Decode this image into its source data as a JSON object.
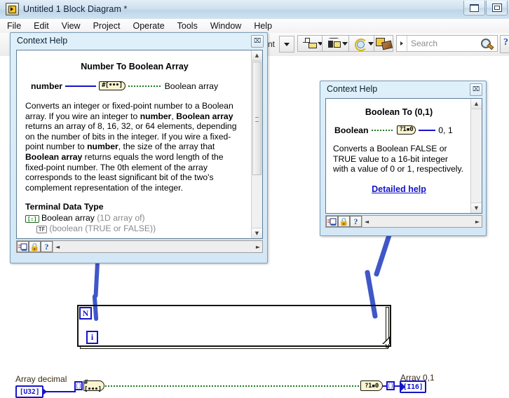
{
  "window": {
    "title": "Untitled 1 Block Diagram *",
    "app_icon": "labview-icon",
    "buttons": [
      {
        "name": "restore-button",
        "glyph": "restore"
      },
      {
        "name": "maximize-button",
        "glyph": "maximize"
      }
    ]
  },
  "menubar": {
    "items": [
      {
        "label": "File"
      },
      {
        "label": "Edit"
      },
      {
        "label": "View"
      },
      {
        "label": "Project"
      },
      {
        "label": "Operate"
      },
      {
        "label": "Tools"
      },
      {
        "label": "Window"
      },
      {
        "label": "Help"
      }
    ]
  },
  "toolbar": {
    "font_label": "nt",
    "align_objects": "align-objects-icon",
    "distribute_objects": "distribute-objects-icon",
    "reorder": "reorder-icon",
    "clean_up_diagram": "clean-up-diagram-icon",
    "search": {
      "placeholder": "Search",
      "value": "",
      "icon": "search-icon"
    },
    "context_help_toggle": "context-help-icon"
  },
  "context_help_1": {
    "title": "Context Help",
    "close_label": "⌧",
    "heading": "Number To Boolean Array",
    "diagram": {
      "input_label": "number",
      "node_glyph": "#[•••]",
      "output_label": "Boolean array"
    },
    "body_segments": [
      {
        "t": "Converts an integer or fixed-point number to a Boolean array. If you wire an integer to ",
        "b": false
      },
      {
        "t": "number",
        "b": true
      },
      {
        "t": ", ",
        "b": false
      },
      {
        "t": "Boolean array",
        "b": true
      },
      {
        "t": " returns an array of 8, 16, 32, or 64 elements, depending on the number of bits in the integer. If you wire a fixed-point number to ",
        "b": false
      },
      {
        "t": "number",
        "b": true
      },
      {
        "t": ", the size of the array that ",
        "b": false
      },
      {
        "t": "Boolean array",
        "b": true
      },
      {
        "t": " returns equals the word length of the fixed-point number. The 0th element of the array corresponds to the least significant bit of the two's complement representation of the integer.",
        "b": false
      }
    ],
    "terminal_section_title": "Terminal Data Type",
    "terminal_rows": [
      {
        "badge": "[:]",
        "name": "Boolean array",
        "note": "(1D array of)",
        "indent": 0
      },
      {
        "badge": "TF",
        "name": "",
        "note": "(boolean (TRUE or FALSE))",
        "indent": 1
      }
    ],
    "statusbar": {
      "buttons": [
        "show-context-help-icon",
        "lock-icon",
        "detailed-help-icon"
      ],
      "scroll_left": "◄",
      "scroll_right": "►"
    }
  },
  "context_help_2": {
    "title": "Context Help",
    "close_label": "⌧",
    "heading": "Boolean To (0,1)",
    "diagram": {
      "input_label": "Boolean",
      "node_glyph": "?1▪0",
      "output_label": "0, 1"
    },
    "body_text": "Converts a Boolean FALSE or TRUE value to a 16-bit integer with a value of 0 or 1, respectively.",
    "link_text": "Detailed help",
    "statusbar": {
      "buttons": [
        "show-context-help-icon",
        "lock-icon",
        "detailed-help-icon"
      ],
      "scroll_left": "◄",
      "scroll_right": "►"
    }
  },
  "block_diagram": {
    "input_label": "Array decimal",
    "input_terminal": "[U32]",
    "output_label": "Array 0,1",
    "output_terminal": "[I16]",
    "loop_count_terminal": "N",
    "loop_index_terminal": "i",
    "node_left": "#[•••]",
    "node_right": "?1▪0",
    "tunnel_left": "[]",
    "tunnel_right": "[]"
  },
  "colors": {
    "wire_blue": "#1614c8",
    "wire_green": "#1d7a1d",
    "node_fill": "#fbf4cf",
    "annotation_blue": "#3f57c8",
    "link_blue": "#1313c8",
    "label_brown": "#3b2a12"
  }
}
